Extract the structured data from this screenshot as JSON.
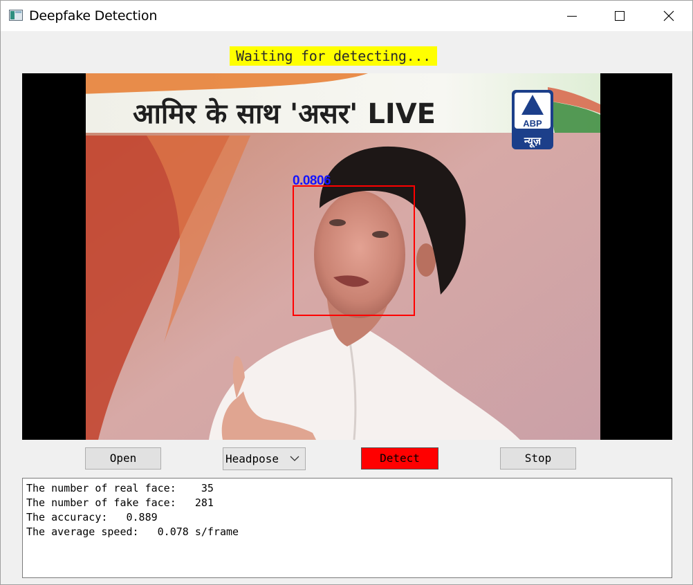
{
  "window": {
    "title": "Deepfake Detection",
    "icon": "app-window-icon",
    "controls": [
      "minimize-icon",
      "maximize-icon",
      "close-icon"
    ]
  },
  "status": {
    "text": "Waiting for detecting...",
    "background": "#ffff00"
  },
  "video": {
    "banner_text": "आमिर के साथ 'असर' LIVE",
    "channel_logo_text": "ABP",
    "channel_logo_subtext": "न्यूज़",
    "detection": {
      "score": "0.0806",
      "box_color": "#ff0000",
      "label_color": "#1515ff"
    }
  },
  "controls": {
    "open_label": "Open",
    "method_selected": "Headpose",
    "detect_label": "Detect",
    "detect_color": "#ff0000",
    "stop_label": "Stop"
  },
  "log": {
    "lines": [
      "The number of real face:    35",
      "The number of fake face:   281",
      "The accuracy:   0.889",
      "The average speed:   0.078 s/frame"
    ]
  }
}
